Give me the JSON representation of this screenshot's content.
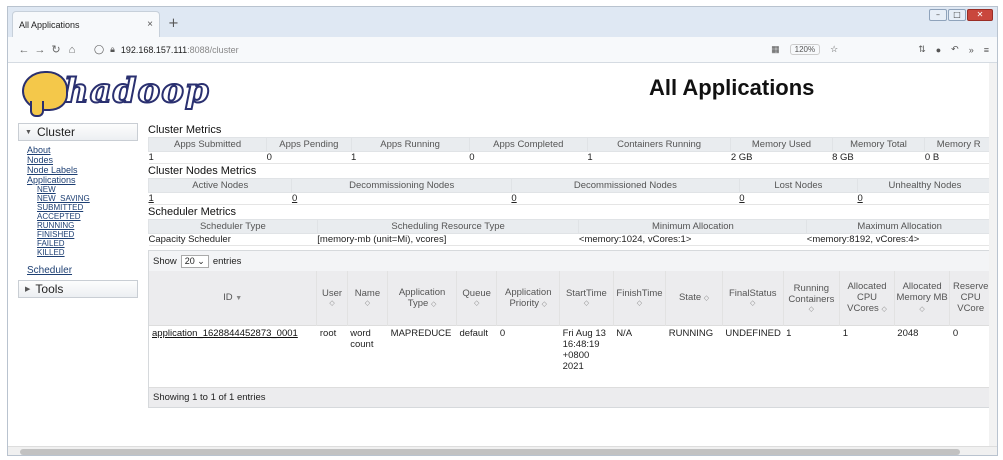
{
  "browser": {
    "tab_title": "All Applications",
    "tab_close": "×",
    "new_tab": "+",
    "url_host": "192.168.157.111",
    "url_rest": ":8088/cluster",
    "zoom": "120%",
    "win_min": "–",
    "win_max": "□",
    "win_close": "✕"
  },
  "page": {
    "title": "All Applications",
    "logo_text": "hadoop"
  },
  "sidebar": {
    "cluster_label": "Cluster",
    "links": [
      "About",
      "Nodes",
      "Node Labels",
      "Applications"
    ],
    "app_states": [
      "NEW",
      "NEW_SAVING",
      "SUBMITTED",
      "ACCEPTED",
      "RUNNING",
      "FINISHED",
      "FAILED",
      "KILLED"
    ],
    "scheduler_label": "Scheduler",
    "tools_label": "Tools"
  },
  "cluster_metrics": {
    "title": "Cluster Metrics",
    "headers": [
      "Apps Submitted",
      "Apps Pending",
      "Apps Running",
      "Apps Completed",
      "Containers Running",
      "Memory Used",
      "Memory Total",
      "Memory R"
    ],
    "values": [
      "1",
      "0",
      "1",
      "0",
      "1",
      "2 GB",
      "8 GB",
      "0 B"
    ]
  },
  "node_metrics": {
    "title": "Cluster Nodes Metrics",
    "headers": [
      "Active Nodes",
      "Decommissioning Nodes",
      "Decommissioned Nodes",
      "Lost Nodes",
      "Unhealthy Nodes"
    ],
    "values": [
      "1",
      "0",
      "0",
      "0",
      "0"
    ]
  },
  "scheduler_metrics": {
    "title": "Scheduler Metrics",
    "headers": [
      "Scheduler Type",
      "Scheduling Resource Type",
      "Minimum Allocation",
      "Maximum Allocation"
    ],
    "values": [
      "Capacity Scheduler",
      "[memory-mb (unit=Mi), vcores]",
      "<memory:1024, vCores:1>",
      "<memory:8192, vCores:4>"
    ]
  },
  "apps": {
    "show_label": "Show",
    "page_size": "20",
    "entries_label": "entries",
    "headers": [
      "ID",
      "User",
      "Name",
      "Application Type",
      "Queue",
      "Application Priority",
      "StartTime",
      "FinishTime",
      "State",
      "FinalStatus",
      "Running Containers",
      "Allocated CPU VCores",
      "Allocated Memory MB",
      "Reserve CPU VCore"
    ],
    "row": {
      "id": "application_1628844452873_0001",
      "user": "root",
      "name": "word count",
      "type": "MAPREDUCE",
      "queue": "default",
      "priority": "0",
      "start": "Fri Aug 13 16:48:19 +0800 2021",
      "finish": "N/A",
      "state": "RUNNING",
      "final": "UNDEFINED",
      "containers": "1",
      "vcores": "1",
      "memory": "2048",
      "reserved": "0"
    },
    "footer": "Showing 1 to 1 of 1 entries"
  }
}
